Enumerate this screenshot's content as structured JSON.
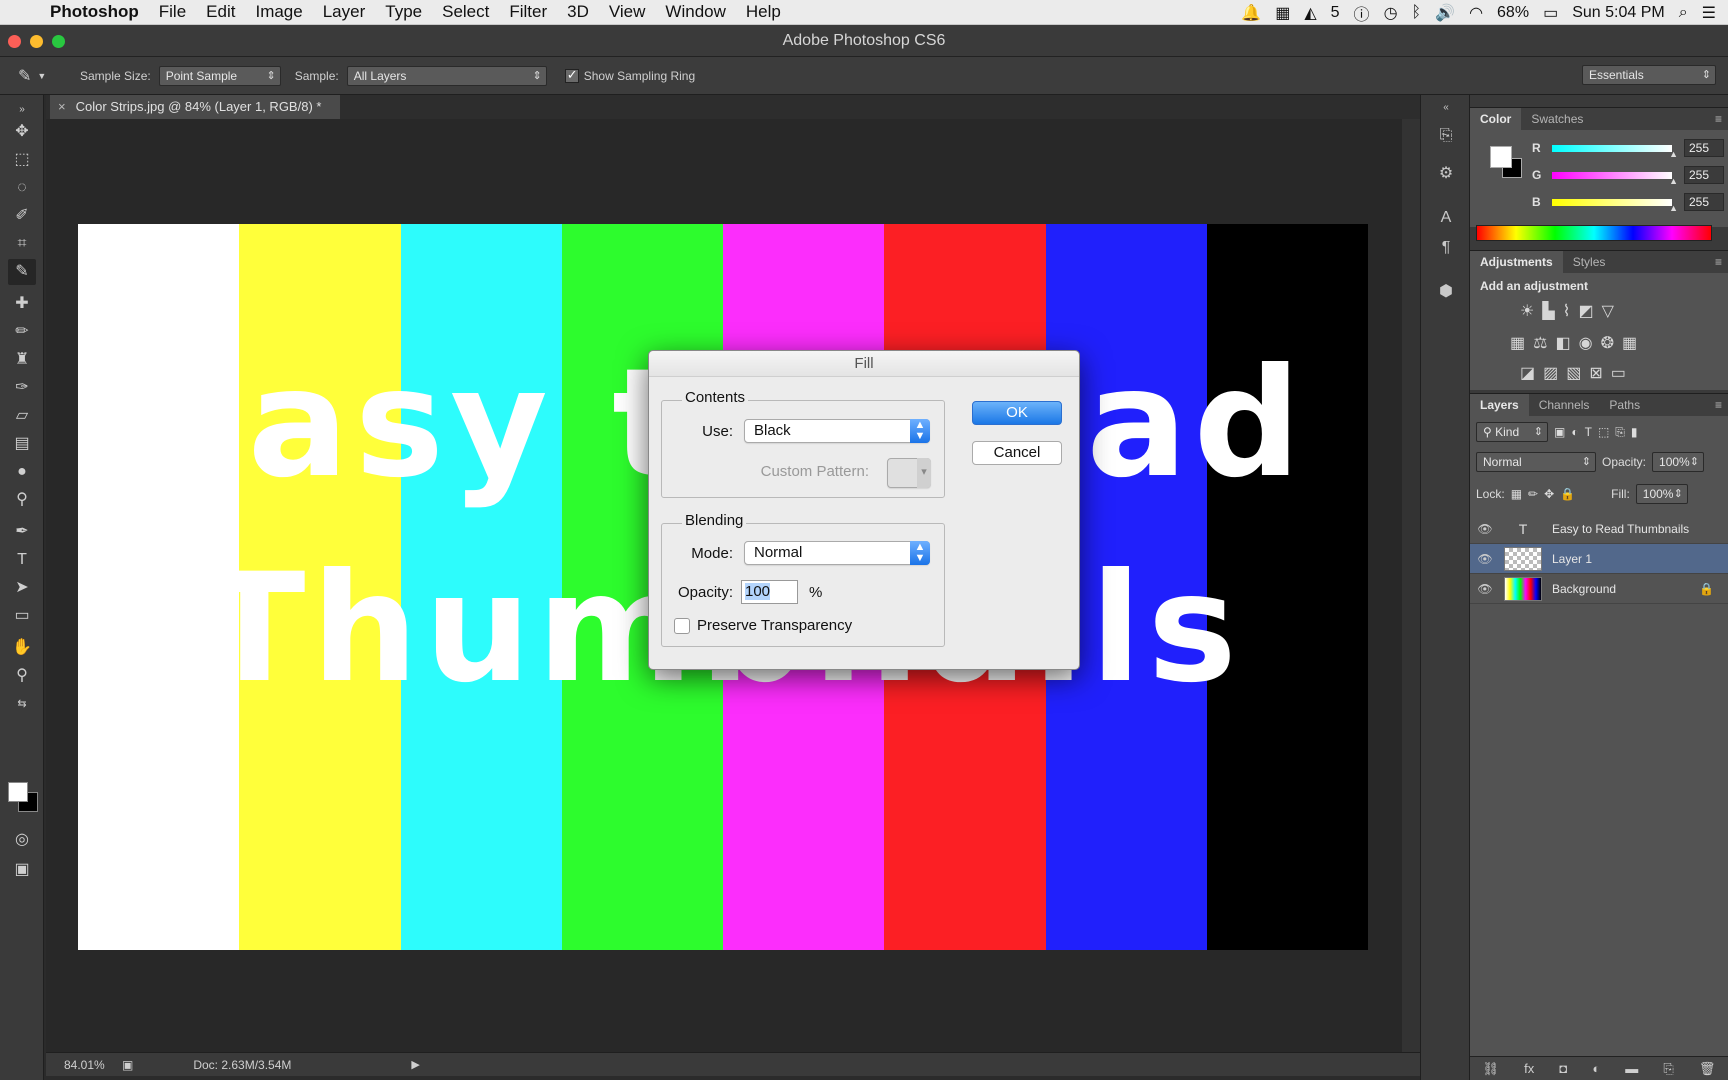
{
  "menubar": {
    "app": "Photoshop",
    "items": [
      "File",
      "Edit",
      "Image",
      "Layer",
      "Type",
      "Select",
      "Filter",
      "3D",
      "View",
      "Window",
      "Help"
    ],
    "status": {
      "adobe_count": "5",
      "battery": "68%",
      "clock": "Sun 5:04 PM"
    }
  },
  "window": {
    "title": "Adobe Photoshop CS6"
  },
  "options_bar": {
    "sample_size_label": "Sample Size:",
    "sample_size_value": "Point Sample",
    "sample_label": "Sample:",
    "sample_value": "All Layers",
    "sampling_ring_label": "Show Sampling Ring",
    "workspace": "Essentials"
  },
  "document": {
    "tab_label": "Color Strips.jpg @ 84% (Layer 1, RGB/8) *",
    "strips": [
      "#ffffff",
      "#ffff3a",
      "#2dfcfc",
      "#2dfc2d",
      "#fc2dfc",
      "#fc1f24",
      "#2020fc",
      "#000000"
    ],
    "line1": "Easy to Read",
    "line2": "Thumbnails"
  },
  "status_bar": {
    "zoom": "84.01%",
    "doc_size": "Doc: 2.63M/3.54M"
  },
  "color_panel": {
    "tabs": [
      "Color",
      "Swatches"
    ],
    "channels": [
      {
        "label": "R",
        "value": "255"
      },
      {
        "label": "G",
        "value": "255"
      },
      {
        "label": "B",
        "value": "255"
      }
    ]
  },
  "adjustments_panel": {
    "tabs": [
      "Adjustments",
      "Styles"
    ],
    "title": "Add an adjustment"
  },
  "layers_panel": {
    "tabs": [
      "Layers",
      "Channels",
      "Paths"
    ],
    "filter_kind": "Kind",
    "blend_mode": "Normal",
    "opacity_label": "Opacity:",
    "opacity_value": "100%",
    "lock_label": "Lock:",
    "fill_label": "Fill:",
    "fill_value": "100%",
    "layers": [
      {
        "name": "Easy to Read Thumbnails"
      },
      {
        "name": "Layer 1"
      },
      {
        "name": "Background"
      }
    ]
  },
  "fill_dialog": {
    "title": "Fill",
    "contents_legend": "Contents",
    "use_label": "Use:",
    "use_value": "Black",
    "custom_pattern_label": "Custom Pattern:",
    "blending_legend": "Blending",
    "mode_label": "Mode:",
    "mode_value": "Normal",
    "opacity_label": "Opacity:",
    "opacity_value": "100",
    "opacity_unit": "%",
    "preserve_label": "Preserve Transparency",
    "ok_label": "OK",
    "cancel_label": "Cancel"
  }
}
